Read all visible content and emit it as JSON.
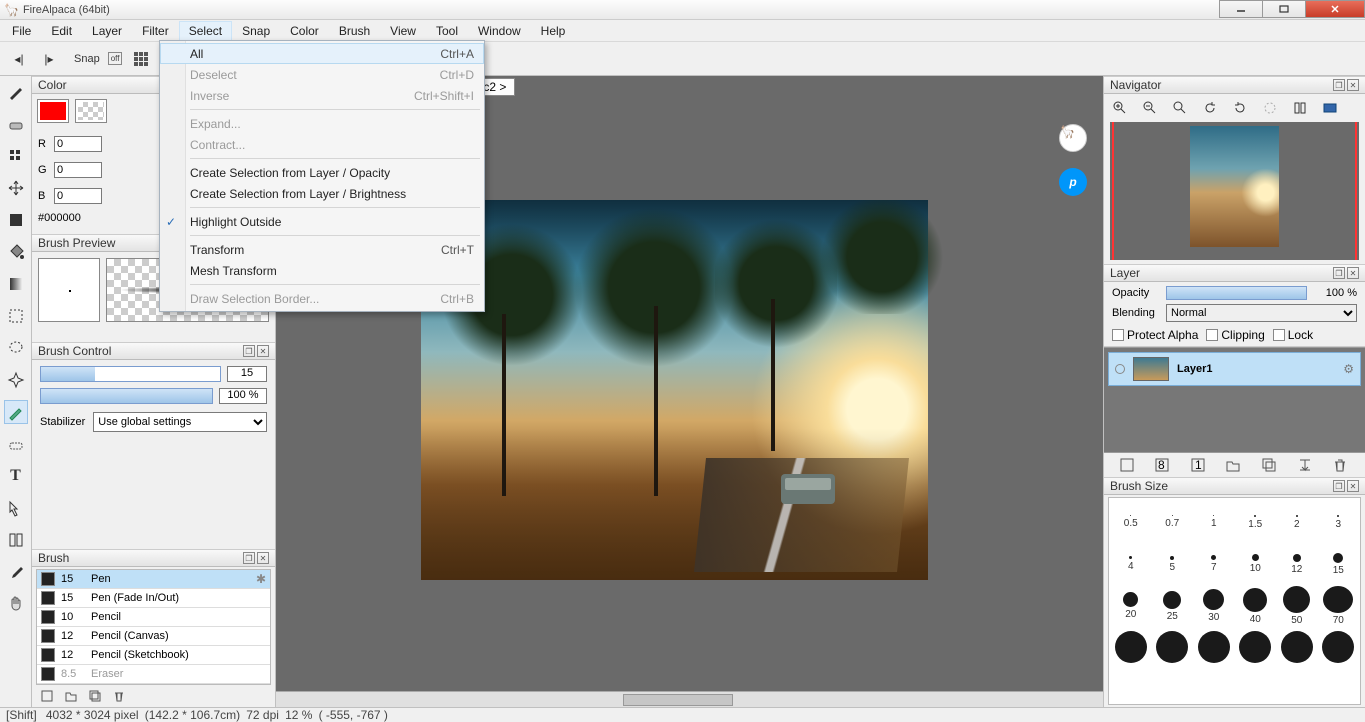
{
  "window": {
    "title": "FireAlpaca (64bit)"
  },
  "menus": [
    "File",
    "Edit",
    "Layer",
    "Filter",
    "Select",
    "Snap",
    "Color",
    "Brush",
    "View",
    "Tool",
    "Window",
    "Help"
  ],
  "open_menu_index": 4,
  "toolbar": {
    "snap_label": "Snap",
    "snap_off": "off"
  },
  "dropdown": {
    "groups": [
      [
        {
          "label": "All",
          "shortcut": "Ctrl+A",
          "hl": true
        },
        {
          "label": "Deselect",
          "shortcut": "Ctrl+D",
          "disabled": true
        },
        {
          "label": "Inverse",
          "shortcut": "Ctrl+Shift+I",
          "disabled": true
        }
      ],
      [
        {
          "label": "Expand...",
          "disabled": true
        },
        {
          "label": "Contract...",
          "disabled": true
        }
      ],
      [
        {
          "label": "Create Selection from Layer / Opacity"
        },
        {
          "label": "Create Selection from Layer / Brightness"
        }
      ],
      [
        {
          "label": "Highlight Outside",
          "checked": true
        }
      ],
      [
        {
          "label": "Transform",
          "shortcut": "Ctrl+T"
        },
        {
          "label": "Mesh Transform"
        }
      ],
      [
        {
          "label": "Draw Selection Border...",
          "shortcut": "Ctrl+B",
          "disabled": true
        }
      ]
    ]
  },
  "color": {
    "panel": "Color",
    "r": "0",
    "g": "0",
    "b": "0",
    "hex": "#000000"
  },
  "brush_preview": {
    "title": "Brush Preview"
  },
  "brush_control": {
    "title": "Brush Control",
    "size_val": "15",
    "size_fill": 30,
    "opac_val": "100 %",
    "opac_fill": 100,
    "stab_label": "Stabilizer",
    "stab_value": "Use global settings"
  },
  "brush_panel": {
    "title": "Brush",
    "items": [
      {
        "size": "15",
        "name": "Pen",
        "sel": true,
        "gear": true
      },
      {
        "size": "15",
        "name": "Pen (Fade In/Out)"
      },
      {
        "size": "10",
        "name": "Pencil"
      },
      {
        "size": "12",
        "name": "Pencil (Canvas)"
      },
      {
        "size": "12",
        "name": "Pencil (Sketchbook)"
      },
      {
        "size": "8.5",
        "name": "Eraser",
        "faded": true
      }
    ]
  },
  "tab": {
    "label": "I-unsplash.jpg < c2 >"
  },
  "pixiv_glyph": "p",
  "navigator": {
    "title": "Navigator"
  },
  "layer": {
    "title": "Layer",
    "opacity_label": "Opacity",
    "opacity_val": "100 %",
    "blending_label": "Blending",
    "blending_val": "Normal",
    "protect": "Protect Alpha",
    "clipping": "Clipping",
    "lock": "Lock",
    "layer_name": "Layer1"
  },
  "brush_size": {
    "title": "Brush Size",
    "rows": [
      [
        {
          "d": 1,
          "l": "0.5"
        },
        {
          "d": 1,
          "l": "0.7"
        },
        {
          "d": 1,
          "l": "1"
        },
        {
          "d": 2,
          "l": "1.5"
        },
        {
          "d": 2,
          "l": "2"
        },
        {
          "d": 2,
          "l": "3"
        }
      ],
      [
        {
          "d": 3,
          "l": "4"
        },
        {
          "d": 4,
          "l": "5"
        },
        {
          "d": 5,
          "l": "7"
        },
        {
          "d": 7,
          "l": "10"
        },
        {
          "d": 8,
          "l": "12"
        },
        {
          "d": 10,
          "l": "15"
        }
      ],
      [
        {
          "d": 15,
          "l": "20"
        },
        {
          "d": 18,
          "l": "25"
        },
        {
          "d": 21,
          "l": "30"
        },
        {
          "d": 24,
          "l": "40"
        },
        {
          "d": 27,
          "l": "50"
        },
        {
          "d": 30,
          "l": "70"
        }
      ],
      [
        {
          "d": 32,
          "l": ""
        },
        {
          "d": 32,
          "l": ""
        },
        {
          "d": 32,
          "l": ""
        },
        {
          "d": 32,
          "l": ""
        },
        {
          "d": 32,
          "l": ""
        },
        {
          "d": 32,
          "l": ""
        }
      ]
    ]
  },
  "status": {
    "shift": "[Shift]",
    "dims": "4032 * 3024 pixel",
    "size_mm": "(142.2 * 106.7cm)",
    "dpi": "72 dpi",
    "zoom": "12 %",
    "pos": "( -555, -767 )"
  }
}
